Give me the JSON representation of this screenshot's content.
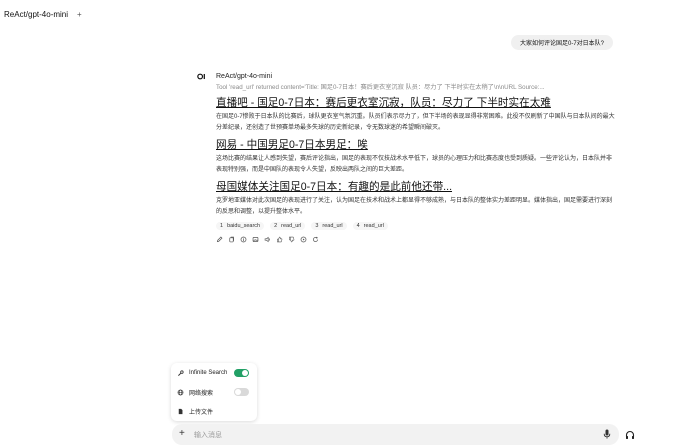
{
  "header": {
    "title": "ReAct/gpt-4o-mini",
    "new_tab_label": "+"
  },
  "user_message": "大家如何评论国足0-7对日本队?",
  "assistant": {
    "model_name": "ReAct/gpt-4o-mini",
    "tool_line": "Tool 'read_url' returned content='Title: 国足0-7日本！赛后更衣室沉寂 队员：尽力了 下半时实在太稍了\\n\\nURL Source:...",
    "results": [
      {
        "title": "直播吧 - 国足0-7日本：赛后更衣室沉寂，队员：尽力了 下半时实在太难",
        "desc": "在国足0-7惨败于日本队的比赛后，球队更衣室气氛沉重。队员们表示尽力了，但下半场的表现显得非常困难。此役不仅刷新了中国队与日本队间的最大分差纪录，还创造了世预赛单场最多失球的历史新纪录，令无数球迷的希望瞬间破灭。"
      },
      {
        "title": "网易 - 中国男足0-7日本男足：唉",
        "desc": "这场比赛的结果让人感到失望，赛后评论指出，国足的表现不仅技战术水平低下，球员的心理压力和比赛态度也受到质疑。一些评论认为，日本队并非表现特别强，而是中国队的表现令人失望，反映出两队之间的巨大差距。"
      },
      {
        "title": "母国媒体关注国足0-7日本：有趣的是此前他还带...",
        "desc": "克罗地亚媒体对此次国足的表现进行了关注，认为国足在技术和战术上都显得不够成熟，与日本队的整体实力差距明显。媒体指出，国足需要进行深刻的反思和调整，以提升整体水平。"
      }
    ],
    "sources": [
      {
        "num": "1",
        "name": "baidu_search"
      },
      {
        "num": "2",
        "name": "read_url"
      },
      {
        "num": "3",
        "name": "read_url"
      },
      {
        "num": "4",
        "name": "read_url"
      }
    ]
  },
  "tools_menu": {
    "items": [
      {
        "label": "Infinite Search",
        "icon": "wrench-icon",
        "toggle_on": true
      },
      {
        "label": "网络搜索",
        "icon": "globe-icon",
        "toggle_on": false
      },
      {
        "label": "上传文件",
        "icon": "file-icon"
      }
    ]
  },
  "input": {
    "placeholder": "输入消息"
  },
  "colors": {
    "toggle_on": "#22a066",
    "toggle_off": "#d9d9d9",
    "link": "#111111",
    "muted": "#8a8a8a"
  }
}
